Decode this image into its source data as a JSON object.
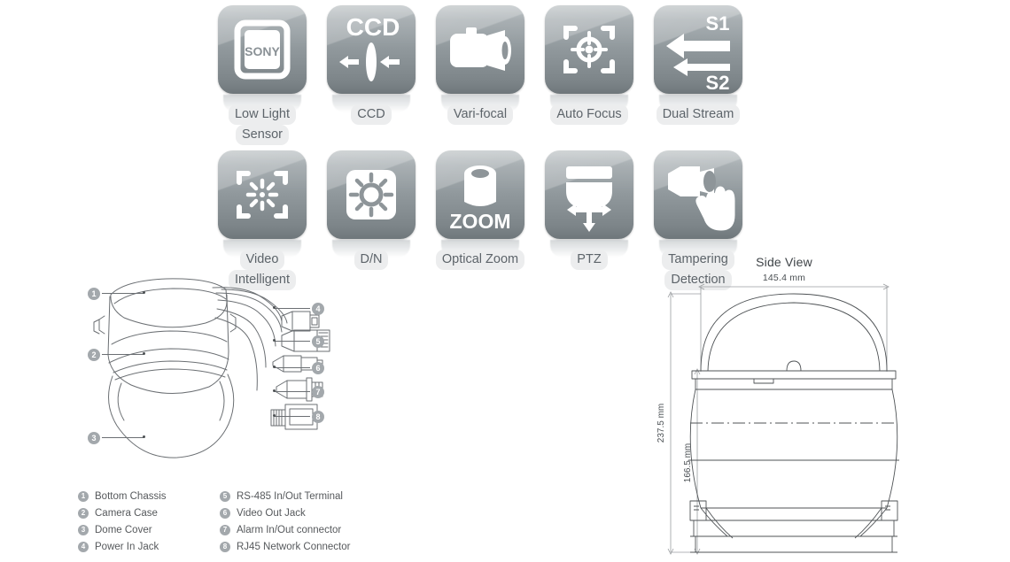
{
  "features": {
    "row1": [
      {
        "label": "Low Light\nSensor",
        "icon": "sony-sensor-icon",
        "name": "low-light-sensor",
        "badge": "SONY"
      },
      {
        "label": "CCD",
        "icon": "ccd-lens-icon",
        "name": "ccd",
        "badge": "CCD"
      },
      {
        "label": "Vari-focal",
        "icon": "varifocal-lens-icon",
        "name": "vari-focal",
        "badge": ""
      },
      {
        "label": "Auto Focus",
        "icon": "auto-focus-target-icon",
        "name": "auto-focus",
        "badge": ""
      },
      {
        "label": "Dual Stream",
        "icon": "dual-stream-arrows-icon",
        "name": "dual-stream",
        "badge": "S1 / S2"
      }
    ],
    "row2": [
      {
        "label": "Video\nIntelligent",
        "icon": "video-intelligent-icon",
        "name": "video-intelligent",
        "badge": ""
      },
      {
        "label": "D/N",
        "icon": "day-night-sun-icon",
        "name": "day-night",
        "badge": ""
      },
      {
        "label": "Optical Zoom",
        "icon": "optical-zoom-lens-icon",
        "name": "optical-zoom",
        "badge": "ZOOM"
      },
      {
        "label": "PTZ",
        "icon": "ptz-dome-arrows-icon",
        "name": "ptz",
        "badge": ""
      },
      {
        "label": "Tampering\nDetection",
        "icon": "tampering-hand-camera-icon",
        "name": "tampering-detection",
        "badge": ""
      }
    ],
    "labels_flat": [
      "Low Light Sensor",
      "CCD",
      "Vari-focal",
      "Auto Focus",
      "Dual Stream",
      "Video Intelligent",
      "D/N",
      "Optical Zoom",
      "PTZ",
      "Tampering Detection"
    ]
  },
  "legend": {
    "column1": [
      {
        "num": "1",
        "text": "Bottom Chassis"
      },
      {
        "num": "2",
        "text": "Camera Case"
      },
      {
        "num": "3",
        "text": "Dome Cover"
      },
      {
        "num": "4",
        "text": "Power In Jack"
      }
    ],
    "column2": [
      {
        "num": "5",
        "text": "RS-485 In/Out Terminal"
      },
      {
        "num": "6",
        "text": "Video Out Jack"
      },
      {
        "num": "7",
        "text": "Alarm In/Out connector"
      },
      {
        "num": "8",
        "text": "RJ45 Network Connector"
      }
    ]
  },
  "callouts": {
    "left": [
      "1",
      "2",
      "3"
    ],
    "right": [
      "4",
      "5",
      "6",
      "7",
      "8"
    ]
  },
  "side_view": {
    "title": "Side View",
    "width_label": "145.4 mm",
    "height_outer_label": "237.5 mm",
    "height_inner_label": "166.5 mm"
  },
  "colors": {
    "tile_top": "#aeb5b8",
    "tile_bottom": "#6f777b",
    "label_text": "#5d646a",
    "label_chip": "#ecedee",
    "badge": "#a3a8ac",
    "line": "#6b6f73"
  }
}
